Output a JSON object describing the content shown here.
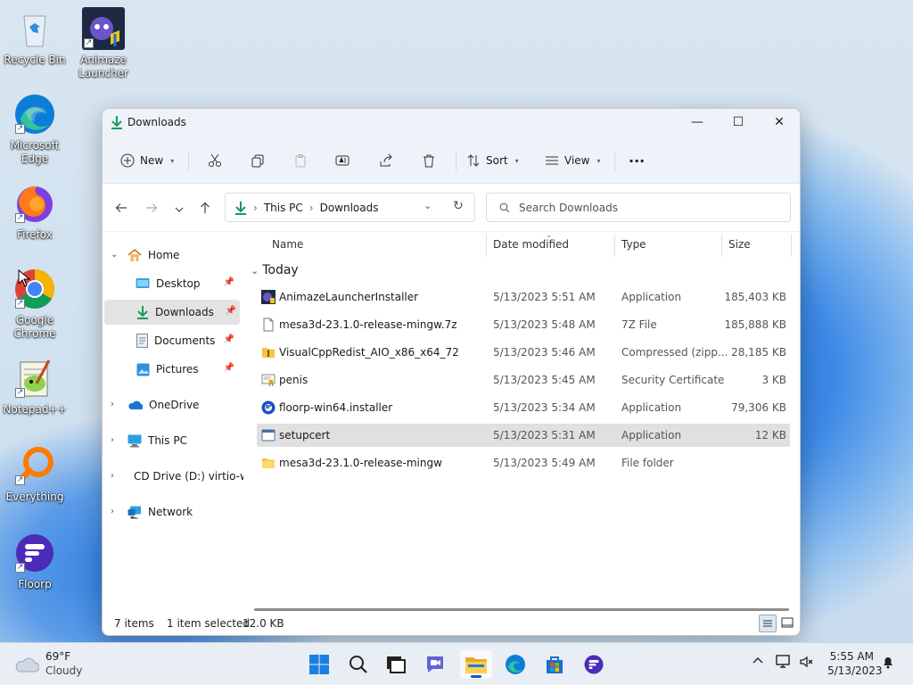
{
  "desktop": {
    "icons": [
      {
        "label": "Recycle Bin"
      },
      {
        "label": "Animaze Launcher"
      },
      {
        "label": "Microsoft Edge"
      },
      {
        "label": "Firefox"
      },
      {
        "label": "Google Chrome"
      },
      {
        "label": "Notepad++"
      },
      {
        "label": "Everything"
      },
      {
        "label": "Floorp"
      }
    ]
  },
  "window": {
    "title": "Downloads",
    "controls": {
      "minimize": "—",
      "maximize": "☐",
      "close": "✕"
    },
    "toolbar": {
      "new_label": "New",
      "sort_label": "Sort",
      "view_label": "View",
      "more_label": "···"
    },
    "address": {
      "root": "This PC",
      "current": "Downloads"
    },
    "search": {
      "placeholder": "Search Downloads"
    },
    "sidebar": {
      "home": "Home",
      "desktop": "Desktop",
      "downloads": "Downloads",
      "documents": "Documents",
      "pictures": "Pictures",
      "onedrive": "OneDrive",
      "thispc": "This PC",
      "cddrive": "CD Drive (D:) virtio-w",
      "network": "Network"
    },
    "columns": {
      "name": "Name",
      "date": "Date modified",
      "type": "Type",
      "size": "Size"
    },
    "group": "Today",
    "files": [
      {
        "name": "AnimazeLauncherInstaller",
        "date": "5/13/2023 5:51 AM",
        "type": "Application",
        "size": "185,403 KB"
      },
      {
        "name": "mesa3d-23.1.0-release-mingw.7z",
        "date": "5/13/2023 5:48 AM",
        "type": "7Z File",
        "size": "185,888 KB"
      },
      {
        "name": "VisualCppRedist_AIO_x86_x64_72",
        "date": "5/13/2023 5:46 AM",
        "type": "Compressed (zipp...",
        "size": "28,185 KB"
      },
      {
        "name": "penis",
        "date": "5/13/2023 5:45 AM",
        "type": "Security Certificate",
        "size": "3 KB"
      },
      {
        "name": "floorp-win64.installer",
        "date": "5/13/2023 5:34 AM",
        "type": "Application",
        "size": "79,306 KB"
      },
      {
        "name": "setupcert",
        "date": "5/13/2023 5:31 AM",
        "type": "Application",
        "size": "12 KB"
      },
      {
        "name": "mesa3d-23.1.0-release-mingw",
        "date": "5/13/2023 5:49 AM",
        "type": "File folder",
        "size": ""
      }
    ],
    "status": {
      "count": "7 items",
      "selection": "1 item selected",
      "selsize": "12.0 KB"
    }
  },
  "taskbar": {
    "weather": {
      "temp": "69°F",
      "condition": "Cloudy"
    },
    "clock": {
      "time": "5:55 AM",
      "date": "5/13/2023"
    },
    "tray_chevron": "^"
  },
  "colors": {
    "accent": "#005fb8",
    "selection": "#e0e0e0",
    "folder": "#f4c542"
  }
}
